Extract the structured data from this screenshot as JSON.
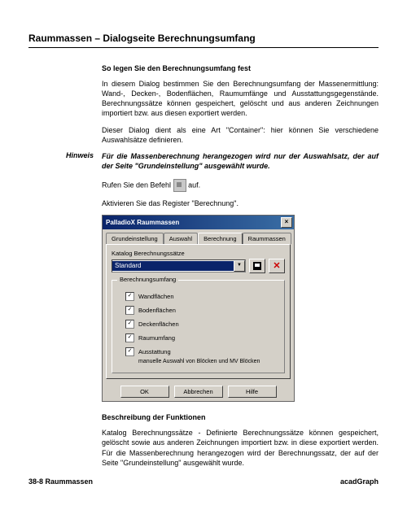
{
  "title": "Raummassen – Dialogseite Berechnungsumfang",
  "subhead1": "So legen Sie den Berechnungsumfang fest",
  "para1": "In diesem Dialog bestimmen Sie den Berechnungsumfang der Massenermittlung: Wand-, Decken-, Bodenflächen, Raumumfänge und Ausstattungsgegenstände. Berechnungssätze können gespeichert, gelöscht und aus anderen Zeichnungen importiert bzw. aus diesen exportiert werden.",
  "para2": "Dieser Dialog dient als eine Art \"Container\": hier können Sie verschiedene Auswahlsätze definieren.",
  "hint_label": "Hinweis",
  "hint_text": "Für die Massenberechnung herangezogen wird nur der Auswahlsatz, der auf der Seite \"Grundeinstellung\" ausgewählt wurde.",
  "line_call_a": "Rufen Sie den Befehl ",
  "line_call_b": " auf.",
  "line_activate": "Aktivieren Sie das Register \"Berechnung\".",
  "dialog": {
    "title": "PalladioX Raummassen",
    "tabs": [
      "Grundeinstellung",
      "Auswahl",
      "Berechnung",
      "Raummassen"
    ],
    "catalog_label": "Katalog Berechnungssätze",
    "catalog_selected": "Standard",
    "groupbox_label": "Berechnungsumfang",
    "checks": {
      "wand": "Wandflächen",
      "boden": "Bodenflächen",
      "decken": "Deckenflächen",
      "raum": "Raumumfang",
      "ausst": "Ausstattung",
      "ausst_note": "manuelle Auswahl von Blöcken und MV Blöcken"
    },
    "buttons": {
      "ok": "OK",
      "cancel": "Abbrechen",
      "help": "Hilfe"
    }
  },
  "subhead2": "Beschreibung der Funktionen",
  "para3": "Katalog Berechnungssätze - Definierte Berechnungssätze können gespeichert, gelöscht sowie aus anderen Zeichnungen importiert bzw. in diese exportiert werden. Für die Massenberechnung herangezogen wird der Berechnungssatz, der auf der Seite \"Grundeinstellung\" ausgewählt wurde.",
  "footer_left": "38-8  Raummassen",
  "footer_right": "acadGraph"
}
